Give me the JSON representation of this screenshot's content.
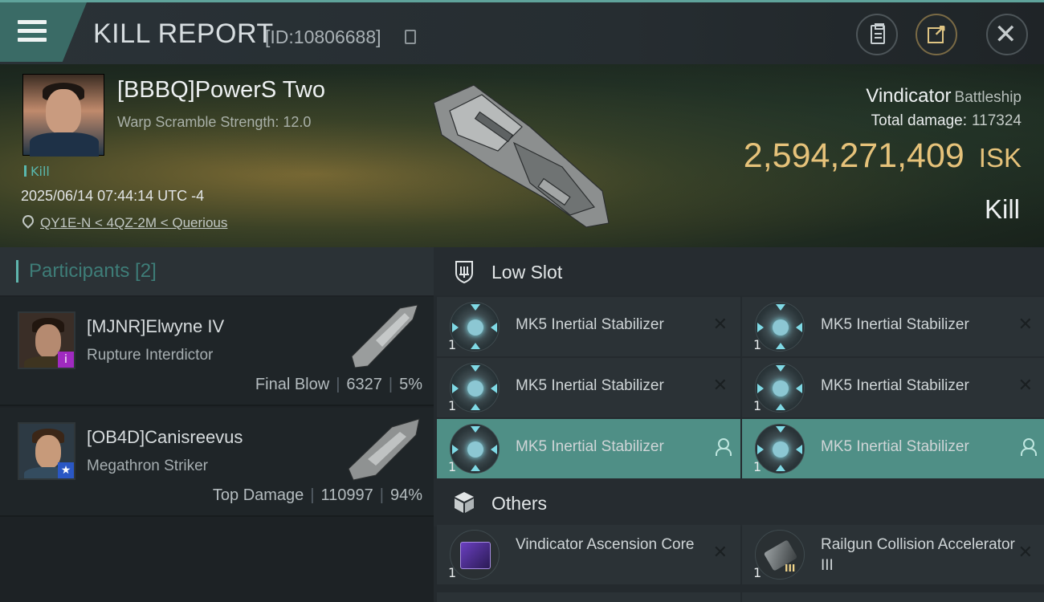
{
  "header": {
    "title": "KILL REPORT",
    "report_id": "[ID:10806688]"
  },
  "victim": {
    "name": "[BBBQ]PowerS Two",
    "warp_scramble": "Warp Scramble Strength: 12.0",
    "tag": "Kill",
    "timestamp": "2025/06/14 07:44:14 UTC -4",
    "location": "QY1E-N < 4QZ-2M < Querious",
    "ship_name": "Vindicator",
    "ship_class": "Battleship",
    "total_damage_label": "Total damage:",
    "total_damage": "117324",
    "isk_value": "2,594,271,409",
    "isk_unit": "ISK",
    "result": "Kill"
  },
  "participants": {
    "title": "Participants [2]",
    "items": [
      {
        "name": "[MJNR]Elwyne IV",
        "ship": "Rupture Interdictor",
        "role": "Final Blow",
        "damage": "6327",
        "percent": "5%",
        "badge": "i"
      },
      {
        "name": "[OB4D]Canisreevus",
        "ship": "Megathron Striker",
        "role": "Top Damage",
        "damage": "110997",
        "percent": "94%",
        "badge": "★"
      }
    ]
  },
  "fitting": {
    "low_slot_title": "Low Slot",
    "low_slots": [
      {
        "name": "MK5 Inertial Stabilizer",
        "qty": "1",
        "status": "destroyed"
      },
      {
        "name": "MK5 Inertial Stabilizer",
        "qty": "1",
        "status": "destroyed"
      },
      {
        "name": "MK5 Inertial Stabilizer",
        "qty": "1",
        "status": "destroyed"
      },
      {
        "name": "MK5 Inertial Stabilizer",
        "qty": "1",
        "status": "destroyed"
      },
      {
        "name": "MK5 Inertial Stabilizer",
        "qty": "1",
        "status": "dropped"
      },
      {
        "name": "MK5 Inertial Stabilizer",
        "qty": "1",
        "status": "dropped"
      }
    ],
    "others_title": "Others",
    "others": [
      {
        "name": "Vindicator Ascension Core",
        "qty": "1",
        "status": "destroyed"
      },
      {
        "name": "Railgun Collision Accelerator III",
        "qty": "1",
        "tier": "III",
        "status": "destroyed"
      }
    ]
  },
  "icons": {
    "menu": "hamburger-menu-icon",
    "copy": "copy-icon",
    "clipboard": "clipboard-icon",
    "share": "share-icon",
    "close": "close-icon",
    "location": "location-pin-icon",
    "low_slot": "low-slot-shield-icon",
    "others": "cube-icon",
    "destroyed": "x-mark-icon",
    "dropped": "person-icon"
  },
  "colors": {
    "accent": "#5fa39b",
    "isk": "#e6c27a",
    "highlight_slot": "#4f8f86"
  }
}
